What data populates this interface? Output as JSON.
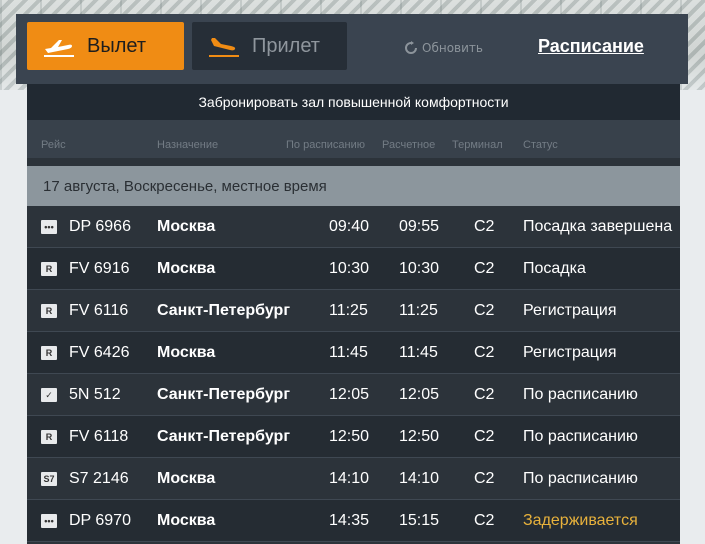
{
  "tabs": {
    "departures": "Вылет",
    "arrivals": "Прилет"
  },
  "refresh_label": "Обновить",
  "schedule_link": "Расписание",
  "banner": "Забронировать зал повышенной комфортности",
  "columns": {
    "flight": "Рейс",
    "destination": "Назначение",
    "scheduled": "По расписанию",
    "estimated": "Расчетное",
    "terminal": "Терминал",
    "status": "Статус"
  },
  "date_header": "17 августа, Воскресенье, местное время",
  "colors": {
    "accent": "#f08c14",
    "delayed": "#e8b23c",
    "board": "#2c333a"
  },
  "flights": [
    {
      "airline_icon": "dots-logo-icon",
      "flight": "DP 6966",
      "destination": "Москва",
      "scheduled": "09:40",
      "estimated": "09:55",
      "terminal": "C2",
      "status": "Посадка завершена",
      "delayed": false
    },
    {
      "airline_icon": "r-logo-icon",
      "flight": "FV 6916",
      "destination": "Москва",
      "scheduled": "10:30",
      "estimated": "10:30",
      "terminal": "C2",
      "status": "Посадка",
      "delayed": false
    },
    {
      "airline_icon": "r-logo-icon",
      "flight": "FV 6116",
      "destination": "Санкт-Петербург",
      "scheduled": "11:25",
      "estimated": "11:25",
      "terminal": "C2",
      "status": "Регистрация",
      "delayed": false
    },
    {
      "airline_icon": "r-logo-icon",
      "flight": "FV 6426",
      "destination": "Москва",
      "scheduled": "11:45",
      "estimated": "11:45",
      "terminal": "C2",
      "status": "Регистрация",
      "delayed": false
    },
    {
      "airline_icon": "bird-logo-icon",
      "flight": "5N 512",
      "destination": "Санкт-Петербург",
      "scheduled": "12:05",
      "estimated": "12:05",
      "terminal": "C2",
      "status": "По расписанию",
      "delayed": false
    },
    {
      "airline_icon": "r-logo-icon",
      "flight": "FV 6118",
      "destination": "Санкт-Петербург",
      "scheduled": "12:50",
      "estimated": "12:50",
      "terminal": "C2",
      "status": "По расписанию",
      "delayed": false
    },
    {
      "airline_icon": "s7-logo-icon",
      "flight": "S7 2146",
      "destination": "Москва",
      "scheduled": "14:10",
      "estimated": "14:10",
      "terminal": "C2",
      "status": "По расписанию",
      "delayed": false
    },
    {
      "airline_icon": "dots-logo-icon",
      "flight": "DP 6970",
      "destination": "Москва",
      "scheduled": "14:35",
      "estimated": "15:15",
      "terminal": "C2",
      "status": "Задерживается",
      "delayed": true
    }
  ]
}
